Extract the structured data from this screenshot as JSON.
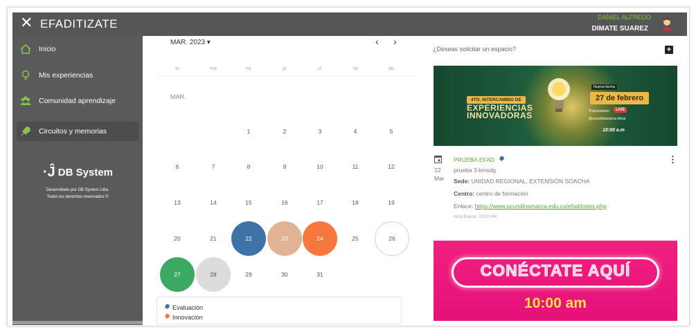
{
  "header": {
    "close_icon": "close-icon",
    "title": "EFADITIZATE",
    "user_first": "DANIEL ALFREDO",
    "user_last": "DIMATE SUAREZ",
    "accent_color": "#8bc34a"
  },
  "sidebar": {
    "items": [
      {
        "label": "Inicio",
        "icon": "home-icon"
      },
      {
        "label": "Mis experiencias",
        "icon": "lightbulb-icon"
      },
      {
        "label": "Comunidad aprendizaje",
        "icon": "community-icon"
      },
      {
        "label": "Circuitos y memorias",
        "icon": "rocket-icon",
        "active": true
      }
    ],
    "logo_text": "DB System",
    "footer_line1": "Desarrollado por DB System Ltda.",
    "footer_line2": "Todos los derechos reservados ©"
  },
  "calendar": {
    "month_select": "MAR. 2023",
    "prev": "‹",
    "next": "›",
    "weekdays": [
      "lu",
      "ma",
      "mi",
      "ju",
      "vi",
      "sá",
      "do"
    ],
    "month_label": "MAR.",
    "days": [
      "1",
      "2",
      "3",
      "4",
      "5",
      "6",
      "7",
      "8",
      "9",
      "10",
      "11",
      "12",
      "13",
      "14",
      "15",
      "16",
      "17",
      "18",
      "19",
      "20",
      "21",
      "22",
      "23",
      "24",
      "25",
      "26",
      "27",
      "28",
      "29",
      "30",
      "31"
    ],
    "highlight_colors": {
      "22": "#3f73a8",
      "23": "#e0b394",
      "24": "#f7773c",
      "27": "#3ca962",
      "28": "#dcdcdc",
      "26": "outline"
    }
  },
  "legend": {
    "items": [
      {
        "label": "Evaluación",
        "icon": "evaluation-icon"
      },
      {
        "label": "Innovación",
        "icon": "innovation-icon"
      }
    ]
  },
  "right_panel": {
    "request_text": "¿Deseas solicitar un espacio?",
    "add_label": "+",
    "banner1": {
      "tag": "4TO. INTERCAMBIO DE",
      "line1": "EXPERIENCIAS",
      "line2": "INNOVADORAS",
      "new_date_label": "Nueva fecha",
      "date": "27 de febrero",
      "transmission": "Transmisión",
      "live": "LIVE",
      "handle": "@ucundinamarca.oficial",
      "time": "10:00 a.m"
    },
    "event": {
      "day": "22",
      "month": "Mar",
      "title": "PRUEBA EFAD",
      "subtitle": "prueba 3 kmsdg",
      "sede_label": "Sede:",
      "sede_value": "UNIDAD REGIONAL, EXTENSIÓN SOACHA",
      "centro_label": "Centro:",
      "centro_value": "centro de formación",
      "enlace_label": "Enlace:",
      "enlace_value": "https://www.ucundinamarca.edu.co/efad/index.php",
      "hour": "Hora Evento: 03:00 PM",
      "more": "⋮"
    },
    "banner2": {
      "text": "CONÉCTATE AQUÍ",
      "time": "10:00 am"
    }
  }
}
